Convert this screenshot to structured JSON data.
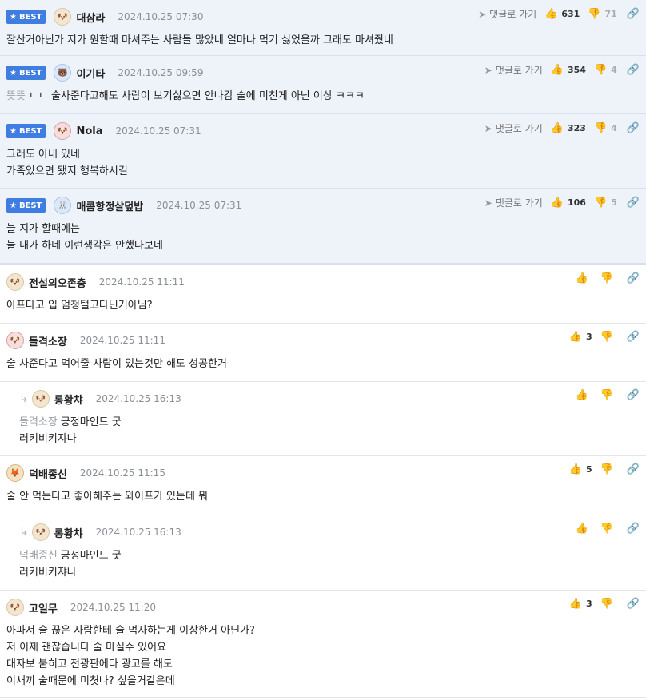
{
  "best_label": "BEST",
  "goto_label": "댓글로 가기",
  "best": [
    {
      "nick": "대삼라",
      "date": "2024.10.25 07:30",
      "up": "631",
      "down": "71",
      "lines": [
        "잘산거아닌가 지가 원할때 마셔주는 사람들 많았네 얼마나 먹기 싫었을까 그래도 마셔줬네"
      ],
      "mention": ""
    },
    {
      "nick": "이기타",
      "date": "2024.10.25 09:59",
      "up": "354",
      "down": "4",
      "mention": "뜻뜻",
      "lines": [
        "ㄴㄴ 술사준다고해도 사람이 보기싫으면 안나감 술에 미친게 아닌 이상 ㅋㅋㅋ"
      ]
    },
    {
      "nick": "Nola",
      "date": "2024.10.25 07:31",
      "up": "323",
      "down": "4",
      "mention": "",
      "lines": [
        "그래도 아내 있네",
        "가족있으면 됐지 행복하시길"
      ]
    },
    {
      "nick": "매콤항정살덮밥",
      "date": "2024.10.25 07:31",
      "up": "106",
      "down": "5",
      "mention": "",
      "lines": [
        "늘 지가 할때에는",
        "늘 내가 하네 이런생각은 안했나보네"
      ]
    }
  ],
  "comments": [
    {
      "nick": "전설의오존충",
      "date": "2024.10.25 11:11",
      "up": "",
      "mention": "",
      "lines": [
        "아프다고 입 엄청털고다닌거아님?"
      ]
    },
    {
      "nick": "돌격소장",
      "date": "2024.10.25 11:11",
      "up": "3",
      "mention": "",
      "lines": [
        "술 사준다고 먹어줄 사람이 있는것만 해도 성공한거"
      ]
    },
    {
      "nick": "롱황챠",
      "date": "2024.10.25 16:13",
      "up": "",
      "mention": "돌격소장",
      "lines": [
        "긍정마인드 굿",
        "러키비키쟈나"
      ]
    },
    {
      "nick": "덕배종신",
      "date": "2024.10.25 11:15",
      "up": "5",
      "mention": "",
      "lines": [
        "술 안 먹는다고 좋아해주는 와이프가 있는데 뭐"
      ]
    },
    {
      "nick": "롱황챠",
      "date": "2024.10.25 16:13",
      "up": "",
      "mention": "덕배종신",
      "lines": [
        "긍정마인드 굿",
        "러키비키쟈나"
      ]
    },
    {
      "nick": "고일무",
      "date": "2024.10.25 11:20",
      "up": "3",
      "mention": "",
      "lines": [
        "아파서 술 끊은 사람한테 술 먹자하는게 이상한거 아닌가?",
        "저 이제 괜찮습니다 술 마실수 있어요",
        "대자보 붙히고 전광판에다 광고를 해도",
        "이새끼 술때문에 미쳣나? 싶을거같은데"
      ]
    }
  ]
}
